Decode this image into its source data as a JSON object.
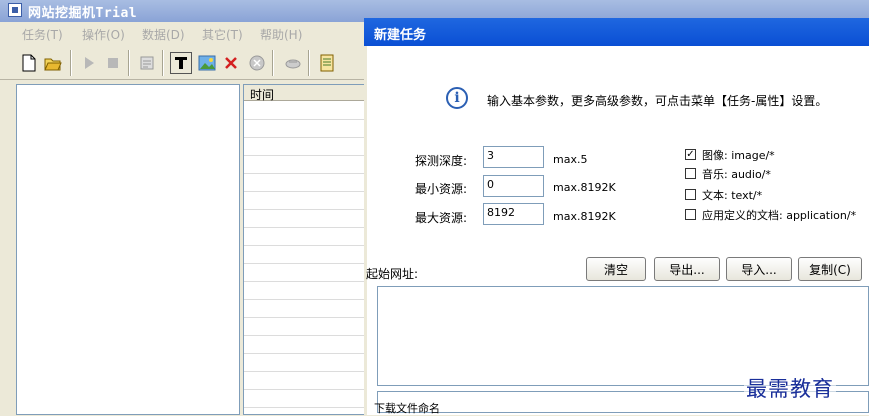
{
  "main_window": {
    "title": "网站挖掘机Trial"
  },
  "menubar": {
    "items": [
      {
        "label": "任务(T)"
      },
      {
        "label": "操作(O)"
      },
      {
        "label": "数据(D)"
      },
      {
        "label": "其它(T)"
      },
      {
        "label": "帮助(H)"
      }
    ]
  },
  "toolbar": {
    "icons": [
      "new-file-icon",
      "open-folder-icon",
      "play-icon",
      "stop-icon",
      "properties-icon",
      "capture-icon",
      "image-icon",
      "delete-icon",
      "close-circle-icon",
      "disconnect-icon",
      "database-icon"
    ]
  },
  "list_pane": {
    "column_header": "时间"
  },
  "dialog": {
    "title": "新建任务",
    "info_text": "输入基本参数，更多高级参数，可点击菜单【任务-属性】设置。",
    "depth": {
      "label": "探测深度:",
      "value": "3",
      "max": "max.5"
    },
    "min_resource": {
      "label": "最小资源:",
      "value": "0",
      "max": "max.8192K"
    },
    "max_resource": {
      "label": "最大资源:",
      "value": "8192",
      "max": "max.8192K"
    },
    "types": [
      {
        "label": "图像: image/*",
        "checked": true
      },
      {
        "label": "音乐: audio/*",
        "checked": false
      },
      {
        "label": "文本: text/*",
        "checked": false
      },
      {
        "label": "应用定义的文档: application/*",
        "checked": false
      }
    ],
    "start_url_label": "起始网址:",
    "buttons": {
      "clear": "清空",
      "export": "导出...",
      "import": "导入...",
      "copy": "复制(C)"
    },
    "url_list": "",
    "download_group_label": "下载文件命名"
  },
  "watermark": "最需教育",
  "colors": {
    "dialog_title": "#0a4fd4",
    "main_title": "#8aa3d6",
    "window_bg": "#ece9d8"
  }
}
